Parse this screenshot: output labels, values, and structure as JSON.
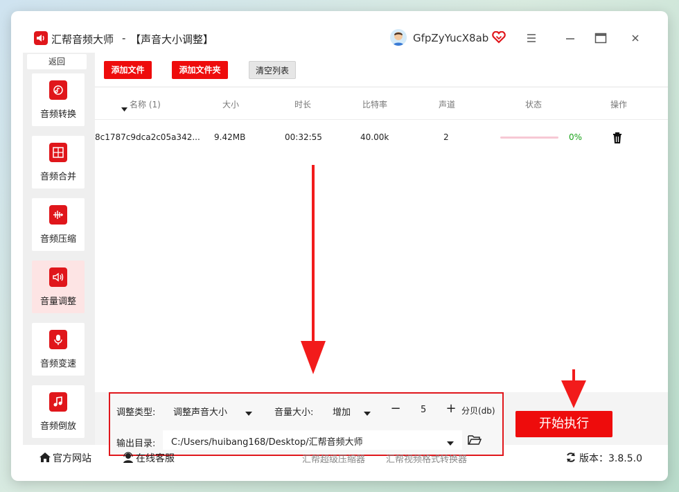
{
  "app": {
    "name": "汇帮音频大师",
    "separator": "-",
    "subtitle": "【声音大小调整】",
    "user": "GfpZyYucX8ab"
  },
  "sidebar": {
    "back": "返回",
    "items": [
      {
        "label": "音频转换",
        "icon": "audio-convert-icon"
      },
      {
        "label": "音频合并",
        "icon": "audio-merge-icon"
      },
      {
        "label": "音频压缩",
        "icon": "audio-compress-icon"
      },
      {
        "label": "音量调整",
        "icon": "volume-icon",
        "active": true
      },
      {
        "label": "音频变速",
        "icon": "mic-icon"
      },
      {
        "label": "音频倒放",
        "icon": "music-note-icon"
      }
    ]
  },
  "toolbar": {
    "add_file": "添加文件",
    "add_folder": "添加文件夹",
    "clear_list": "清空列表"
  },
  "table": {
    "columns": [
      "名称 (1)",
      "大小",
      "时长",
      "比特率",
      "声道",
      "状态",
      "操作"
    ],
    "rows": [
      {
        "name": "8c1787c9dca2c05a342...",
        "size": "9.42MB",
        "duration": "00:32:55",
        "bitrate": "40.00k",
        "channels": "2",
        "progress": 0,
        "status": "0%"
      }
    ]
  },
  "settings": {
    "adjust_type_label": "调整类型:",
    "adjust_type_value": "调整声音大小",
    "volume_label": "音量大小:",
    "volume_mode": "增加",
    "volume_value": "5",
    "minus": "−",
    "plus": "+",
    "unit": "分贝(db)",
    "output_label": "输出目录:",
    "output_path": "C:/Users/huibang168/Desktop/汇帮音频大师"
  },
  "start_button": "开始执行",
  "footer": {
    "website": "官方网站",
    "support": "在线客服",
    "link1": "汇帮超级压缩器",
    "link2": "汇帮视频格式转换器",
    "version": "版本：3.8.5.0"
  },
  "colors": {
    "accent": "#ee0c0c",
    "progress_track": "#f7c8d4",
    "status_ok": "#1aa31a"
  }
}
